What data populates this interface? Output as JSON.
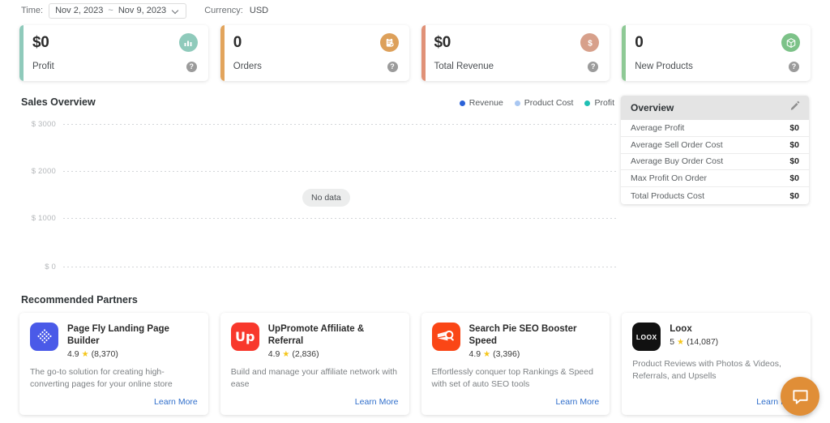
{
  "topbar": {
    "time_label": "Time:",
    "date_start": "Nov 2, 2023",
    "date_sep": "~",
    "date_end": "Nov 9, 2023",
    "currency_label": "Currency:",
    "currency_value": "USD"
  },
  "stats": [
    {
      "value": "$0",
      "label": "Profit",
      "accent": "#8fcabb",
      "icon_bg": "#8fcabb",
      "icon": "bar-chart-icon",
      "help": "?"
    },
    {
      "value": "0",
      "label": "Orders",
      "accent": "#e2a45c",
      "icon_bg": "#dda05a",
      "icon": "order-clipboard-icon",
      "help": "?"
    },
    {
      "value": "$0",
      "label": "Total Revenue",
      "accent": "#e09177",
      "icon_bg": "#d7a08b",
      "icon": "dollar-icon",
      "help": "?"
    },
    {
      "value": "0",
      "label": "New Products",
      "accent": "#8ec995",
      "icon_bg": "#7cc288",
      "icon": "package-box-icon",
      "help": "?"
    }
  ],
  "sales": {
    "title": "Sales Overview",
    "no_data": "No data",
    "legend": [
      {
        "label": "Revenue",
        "color": "#2a62d8"
      },
      {
        "label": "Product Cost",
        "color": "#a9c7f2"
      },
      {
        "label": "Profit",
        "color": "#1fc0b4"
      }
    ]
  },
  "chart_data": {
    "type": "line",
    "title": "Sales Overview",
    "xlabel": "",
    "ylabel": "",
    "ylim": [
      0,
      3000
    ],
    "yticks": [
      "$ 3000",
      "$ 2000",
      "$ 1000",
      "$ 0"
    ],
    "ytick_values": [
      3000,
      2000,
      1000,
      0
    ],
    "grid": true,
    "legend_position": "top-right",
    "empty_state": "No data",
    "categories": [],
    "series": [
      {
        "name": "Revenue",
        "values": []
      },
      {
        "name": "Product Cost",
        "values": []
      },
      {
        "name": "Profit",
        "values": []
      }
    ]
  },
  "overview": {
    "title": "Overview",
    "edit_icon": "pencil-icon",
    "rows": [
      {
        "label": "Average Profit",
        "value": "$0"
      },
      {
        "label": "Average Sell Order Cost",
        "value": "$0"
      },
      {
        "label": "Average Buy Order Cost",
        "value": "$0"
      },
      {
        "label": "Max Profit On Order",
        "value": "$0"
      },
      {
        "label": "Total Products Cost",
        "value": "$0"
      }
    ]
  },
  "partners": {
    "title": "Recommended Partners",
    "learn_more": "Learn More",
    "items": [
      {
        "name": "Page Fly Landing Page Builder",
        "rating": "4.9",
        "reviews": "(8,370)",
        "desc": "The go-to solution for creating high-converting pages for your online store",
        "icon": "pagefly-diamond-icon",
        "icon_bg": "#4a5ae8",
        "learn_more": "Learn More"
      },
      {
        "name": "UpPromote Affiliate & Referral",
        "rating": "4.9",
        "reviews": "(2,836)",
        "desc": "Build and manage your affiliate network with ease",
        "icon": "uppromote-up-icon",
        "icon_bg": "#f8382c",
        "logo_text": "Up",
        "learn_more": "Learn More"
      },
      {
        "name": "Search Pie SEO Booster Speed",
        "rating": "4.9",
        "reviews": "(3,396)",
        "desc": "Effortlessly conquer top Rankings & Speed with set of auto SEO tools",
        "icon": "searchpie-magnifier-icon",
        "icon_bg": "#fa4616",
        "learn_more": "Learn More"
      },
      {
        "name": "Loox",
        "rating": "5",
        "reviews": "(14,087)",
        "desc": "Product Reviews with Photos & Videos, Referrals, and Upsells",
        "icon": "loox-wordmark-icon",
        "icon_bg": "#111111",
        "logo_text": "LOOX",
        "learn_more": "Learn More"
      }
    ]
  },
  "chat": {
    "icon": "chat-bubble-icon",
    "color": "#e08e37"
  }
}
